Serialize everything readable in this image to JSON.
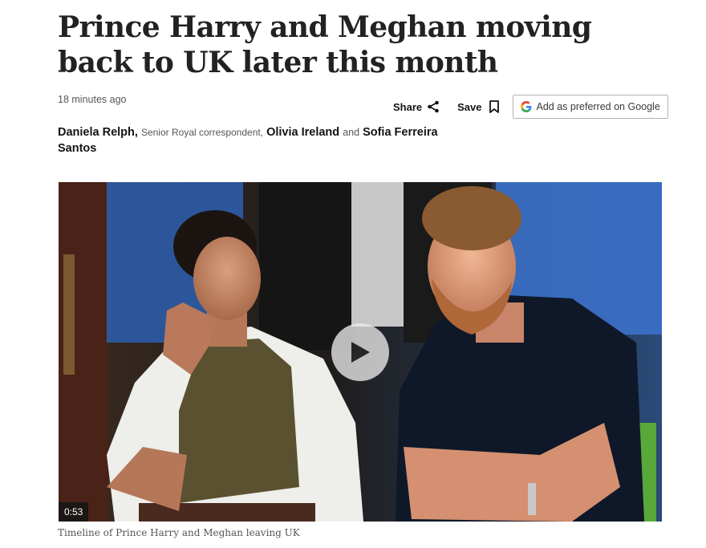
{
  "article": {
    "headline": "Prince Harry and Meghan moving back to UK later this month",
    "timestamp": "18 minutes ago"
  },
  "actions": {
    "share_label": "Share",
    "save_label": "Save",
    "google_label": "Add as preferred on Google"
  },
  "byline": {
    "author1": "Daniela Relph,",
    "author1_role": "Senior Royal correspondent,",
    "author2": "Olivia Ireland",
    "conjunction": "and",
    "author3": "Sofia Ferreira Santos"
  },
  "video": {
    "duration": "0:53",
    "caption": "Timeline of Prince Harry and Meghan leaving UK"
  },
  "icons": {
    "share": "share-icon",
    "save": "bookmark-icon",
    "google": "google-g-icon",
    "play": "play-icon"
  },
  "colors": {
    "text": "#141414",
    "muted": "#545658",
    "google_blue": "#4285F4",
    "google_red": "#EA4335",
    "google_yellow": "#FBBC05",
    "google_green": "#34A853"
  }
}
